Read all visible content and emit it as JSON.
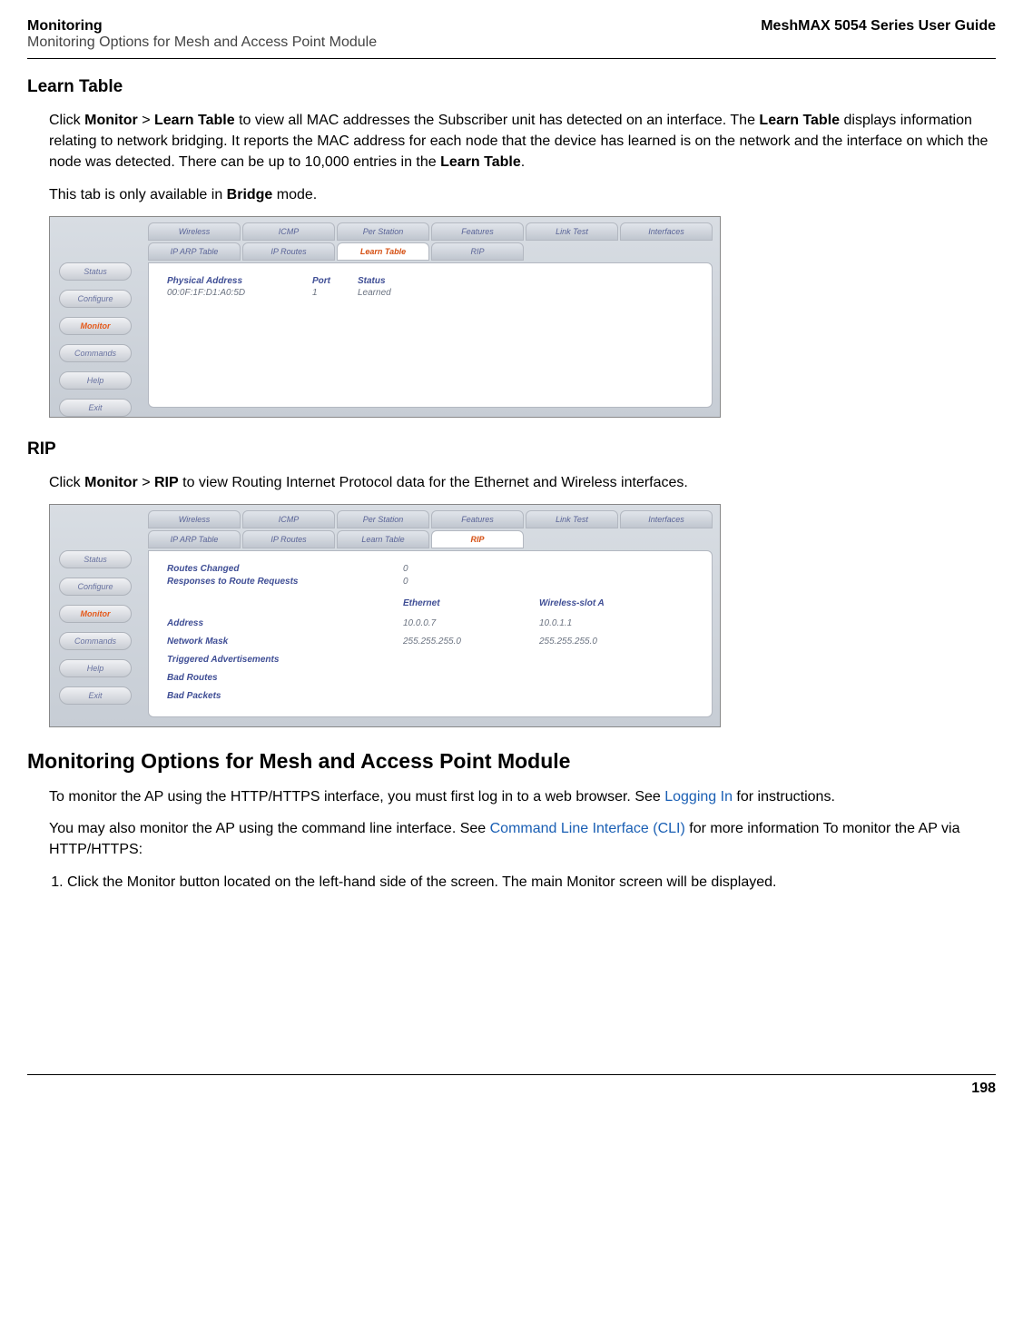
{
  "header": {
    "title_left_bold": "Monitoring",
    "subtitle_left": "Monitoring Options for Mesh and Access Point Module",
    "title_right": "MeshMAX 5054 Series User Guide"
  },
  "learn_table": {
    "heading": "Learn Table",
    "para1_pre": "Click ",
    "para1_mon": "Monitor",
    "para1_gt": " > ",
    "para1_lt": "Learn Table",
    "para1_mid": " to view all MAC addresses the Subscriber unit has detected on an interface. The ",
    "para1_lt2": "Learn Table",
    "para1_mid2": " displays information relating to network bridging. It reports the MAC address for each node that the device has learned is on the network and the interface on which the node was detected. There can be up to 10,000 entries in the ",
    "para1_lt3": "Learn Table",
    "para1_end": ".",
    "para2_pre": "This tab is only available in ",
    "para2_bridge": "Bridge",
    "para2_end": " mode."
  },
  "screenshot_learn": {
    "sidebar": [
      "Status",
      "Configure",
      "Monitor",
      "Commands",
      "Help",
      "Exit"
    ],
    "tab_row1": [
      "Wireless",
      "ICMP",
      "Per Station",
      "Features",
      "Link Test",
      "Interfaces"
    ],
    "tab_row2": [
      "IP ARP Table",
      "IP Routes",
      "Learn Table",
      "RIP"
    ],
    "headers": {
      "addr": "Physical Address",
      "port": "Port",
      "status": "Status"
    },
    "row": {
      "addr": "00:0F:1F:D1:A0:5D",
      "port": "1",
      "status": "Learned"
    }
  },
  "rip": {
    "heading": "RIP",
    "para_pre": "Click ",
    "para_mon": "Monitor",
    "para_gt": " > ",
    "para_rip": "RIP",
    "para_end": " to view Routing Internet Protocol data for the Ethernet and Wireless interfaces."
  },
  "screenshot_rip": {
    "sidebar": [
      "Status",
      "Configure",
      "Monitor",
      "Commands",
      "Help",
      "Exit"
    ],
    "tab_row1": [
      "Wireless",
      "ICMP",
      "Per Station",
      "Features",
      "Link Test",
      "Interfaces"
    ],
    "tab_row2": [
      "IP ARP Table",
      "IP Routes",
      "Learn Table",
      "RIP"
    ],
    "lines": {
      "routes_changed": {
        "label": "Routes Changed",
        "v1": "0"
      },
      "responses": {
        "label": "Responses to Route Requests",
        "v1": "0"
      },
      "col_headers": {
        "c1": "Ethernet",
        "c2": "Wireless-slot A"
      },
      "address": {
        "label": "Address",
        "c1": "10.0.0.7",
        "c2": "10.0.1.1"
      },
      "netmask": {
        "label": "Network Mask",
        "c1": "255.255.255.0",
        "c2": "255.255.255.0"
      },
      "trigadv": {
        "label": "Triggered Advertisements"
      },
      "badroutes": {
        "label": "Bad Routes"
      },
      "badpackets": {
        "label": "Bad Packets"
      }
    }
  },
  "monitoring_options": {
    "heading": "Monitoring Options for Mesh and Access Point Module",
    "para1_pre": "To monitor the AP using the HTTP/HTTPS interface, you must first log in to a web browser. See ",
    "para1_link": "Logging In",
    "para1_end": " for instructions.",
    "para2_pre": "You may also monitor the AP using the command line interface. See ",
    "para2_link": "Command Line Interface (CLI)",
    "para2_end": " for more information To monitor the AP via HTTP/HTTPS:",
    "list1_pre": "Click the ",
    "list1_mon": "Monitor",
    "list1_mid": " button located on the left-hand side of the screen. The main ",
    "list1_mon2": "Monitor",
    "list1_end": " screen will be displayed."
  },
  "footer": {
    "page": "198"
  }
}
